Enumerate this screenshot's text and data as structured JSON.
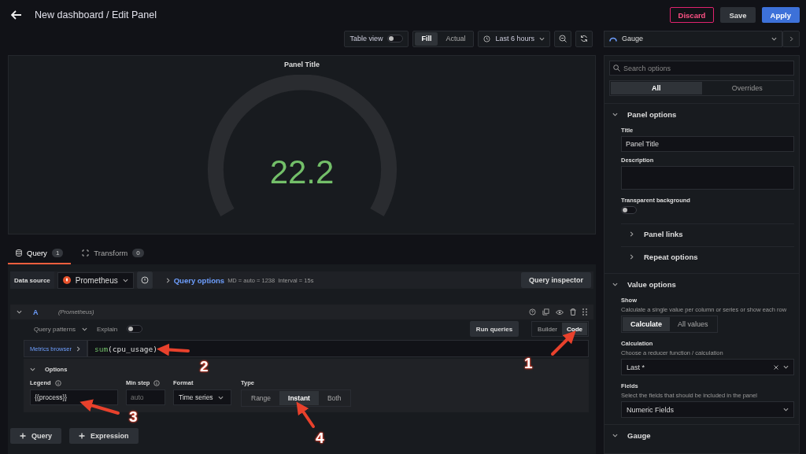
{
  "header": {
    "title": "New dashboard / Edit Panel",
    "buttons": [
      {
        "label": "Discard",
        "kind": "danger"
      },
      {
        "label": "Save",
        "kind": "secondary"
      },
      {
        "label": "Apply",
        "kind": "primary"
      }
    ]
  },
  "toolbar": {
    "table_view": {
      "label": "Table view",
      "on": false
    },
    "fill_modes": [
      {
        "label": "Fill",
        "selected": true
      },
      {
        "label": "Actual",
        "selected": false
      }
    ],
    "time_range": "Last 6 hours"
  },
  "visualization": {
    "name": "Gauge"
  },
  "panel": {
    "title": "Panel Title",
    "value": "22.2"
  },
  "query_tabs": [
    {
      "label": "Query",
      "count": "1",
      "selected": true
    },
    {
      "label": "Transform",
      "count": "0",
      "selected": false
    }
  ],
  "data_source": {
    "label": "Data source",
    "name": "Prometheus",
    "options_label": "Query options",
    "md": "MD = auto = 1238",
    "interval": "Interval = 15s",
    "inspector": "Query inspector"
  },
  "query": {
    "ref": "A",
    "source": "(Prometheus)",
    "patterns": "Query patterns",
    "explain": {
      "label": "Explain",
      "on": false
    },
    "run": "Run queries",
    "modes": [
      {
        "label": "Builder",
        "selected": false
      },
      {
        "label": "Code",
        "selected": true
      }
    ],
    "metrics_browser": "Metrics browser",
    "expr_function": "sum",
    "expr_rest": "(cpu_usage)",
    "options": {
      "label": "Options",
      "expanded": true,
      "legend": {
        "label": "Legend",
        "value": "{{process}}"
      },
      "min_step": {
        "label": "Min step",
        "placeholder": "auto"
      },
      "format": {
        "label": "Format",
        "value": "Time series"
      },
      "type": {
        "label": "Type",
        "options": [
          {
            "label": "Range",
            "selected": false
          },
          {
            "label": "Instant",
            "selected": true
          },
          {
            "label": "Both",
            "selected": false
          }
        ]
      }
    }
  },
  "add_buttons": [
    "Query",
    "Expression"
  ],
  "options_pane": {
    "search_placeholder": "Search options",
    "tabs": [
      {
        "label": "All",
        "selected": true
      },
      {
        "label": "Overrides",
        "selected": false
      }
    ],
    "panel_options": {
      "label": "Panel options",
      "expanded": true,
      "title_label": "Title",
      "title_value": "Panel Title",
      "description_label": "Description",
      "transparent_label": "Transparent background",
      "transparent_on": false,
      "subsections": [
        {
          "label": "Panel links",
          "expanded": false
        },
        {
          "label": "Repeat options",
          "expanded": false
        }
      ]
    },
    "value_options": {
      "label": "Value options",
      "expanded": true,
      "show_label": "Show",
      "show_desc": "Calculate a single value per column or series or show each row",
      "show_options": [
        {
          "label": "Calculate",
          "selected": true
        },
        {
          "label": "All values",
          "selected": false
        }
      ],
      "calc_label": "Calculation",
      "calc_desc": "Choose a reducer function / calculation",
      "calc_value": "Last *",
      "fields_label": "Fields",
      "fields_desc": "Select the fields that should be included in the panel",
      "fields_value": "Numeric Fields"
    },
    "gauge": {
      "label": "Gauge",
      "expanded": true
    }
  },
  "annotations": [
    {
      "label": "1"
    },
    {
      "label": "2"
    },
    {
      "label": "3"
    },
    {
      "label": "4"
    }
  ]
}
